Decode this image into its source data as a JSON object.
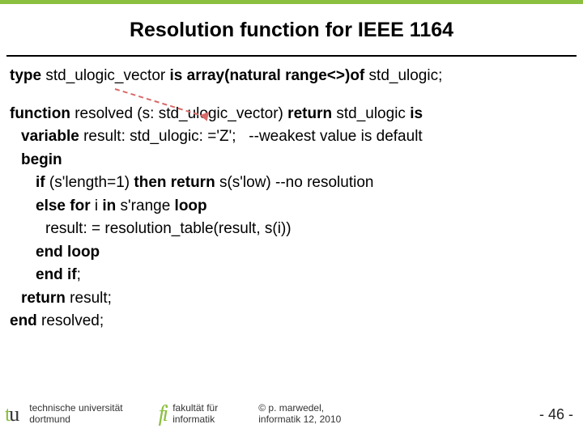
{
  "title": "Resolution function for IEEE 1164",
  "line1": {
    "kw_type": "type",
    "name": " std_ulogic_vector ",
    "rest": "is array(natural range<>)of",
    "tail": " std_ulogic;"
  },
  "code": {
    "l1_kw": "function",
    "l1_mid": " resolved (s: std_ulogic_vector) ",
    "l1_kw2": "return",
    "l1_mid2": " std_ulogic ",
    "l1_kw3": "is",
    "l2_kw": "variable",
    "l2_rest": " result: std_ulogic: ='Z';   --weakest value is default",
    "l3": "begin",
    "l4_kw1": "if",
    "l4_mid": " (s'length=1) ",
    "l4_kw2": "then return",
    "l4_tail": " s(s'low) --no resolution",
    "l5_kw1": "else for",
    "l5_mid": " i ",
    "l5_kw2": "in",
    "l5_mid2": " s'range ",
    "l5_kw3": "loop",
    "l6": "result: = resolution_table(result, s(i))",
    "l7": "end loop",
    "l8": "end if",
    "l8_semi": ";",
    "l9_kw": "return",
    "l9_rest": " result;",
    "l10": "end",
    "l10_rest": " resolved;"
  },
  "footer": {
    "tu1": "technische universität",
    "tu2": "dortmund",
    "fi1": "fakultät für",
    "fi2": "informatik",
    "cp1": "©  p. marwedel,",
    "cp2": "informatik 12,  2010",
    "page": "-  46 -"
  }
}
